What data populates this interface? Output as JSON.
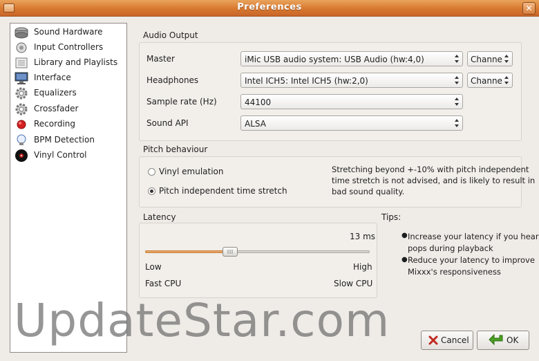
{
  "window": {
    "title": "Preferences"
  },
  "sidebar": {
    "items": [
      {
        "label": "Sound Hardware",
        "icon": "speaker-icon"
      },
      {
        "label": "Input Controllers",
        "icon": "controller-icon"
      },
      {
        "label": "Library and Playlists",
        "icon": "library-icon"
      },
      {
        "label": "Interface",
        "icon": "monitor-icon"
      },
      {
        "label": "Equalizers",
        "icon": "gear-icon"
      },
      {
        "label": "Crossfader",
        "icon": "gear-icon"
      },
      {
        "label": "Recording",
        "icon": "record-icon"
      },
      {
        "label": "BPM Detection",
        "icon": "bulb-icon"
      },
      {
        "label": "Vinyl Control",
        "icon": "vinyl-icon"
      }
    ]
  },
  "audio_output": {
    "title": "Audio Output",
    "master": {
      "label": "Master",
      "device": "iMic USB audio system: USB Audio (hw:4,0)",
      "channel": "Channe"
    },
    "headphones": {
      "label": "Headphones",
      "device": "Intel ICH5: Intel ICH5 (hw:2,0)",
      "channel": "Channe"
    },
    "sample_rate": {
      "label": "Sample rate (Hz)",
      "value": "44100"
    },
    "sound_api": {
      "label": "Sound API",
      "value": "ALSA"
    }
  },
  "pitch": {
    "title": "Pitch behaviour",
    "option_vinyl": "Vinyl emulation",
    "option_stretch": "Pitch independent time stretch",
    "selected": "stretch",
    "note_line1": "Stretching beyond +-10% with pitch independent",
    "note_line2": "time stretch is not advised, and is likely to result in",
    "note_line3": "bad sound quality."
  },
  "latency": {
    "title": "Latency",
    "value_text": "13 ms",
    "slider_fraction": 0.37,
    "low": "Low",
    "high": "High",
    "fast": "Fast CPU",
    "slow": "Slow CPU"
  },
  "tips": {
    "title": "Tips:",
    "tip1_line1": "Increase your latency if you hear",
    "tip1_line2": "pops during playback",
    "tip2_line1": "Reduce your latency to improve",
    "tip2_line2": "Mixxx's responsiveness"
  },
  "buttons": {
    "cancel": "Cancel",
    "ok": "OK"
  },
  "watermark": "UpdateStar.com",
  "colors": {
    "titlebar": "#d8782f",
    "slider_fill": "#e8a25f",
    "ok_arrow": "#4aa023",
    "cancel_x": "#c0281e",
    "record": "#d32020"
  }
}
